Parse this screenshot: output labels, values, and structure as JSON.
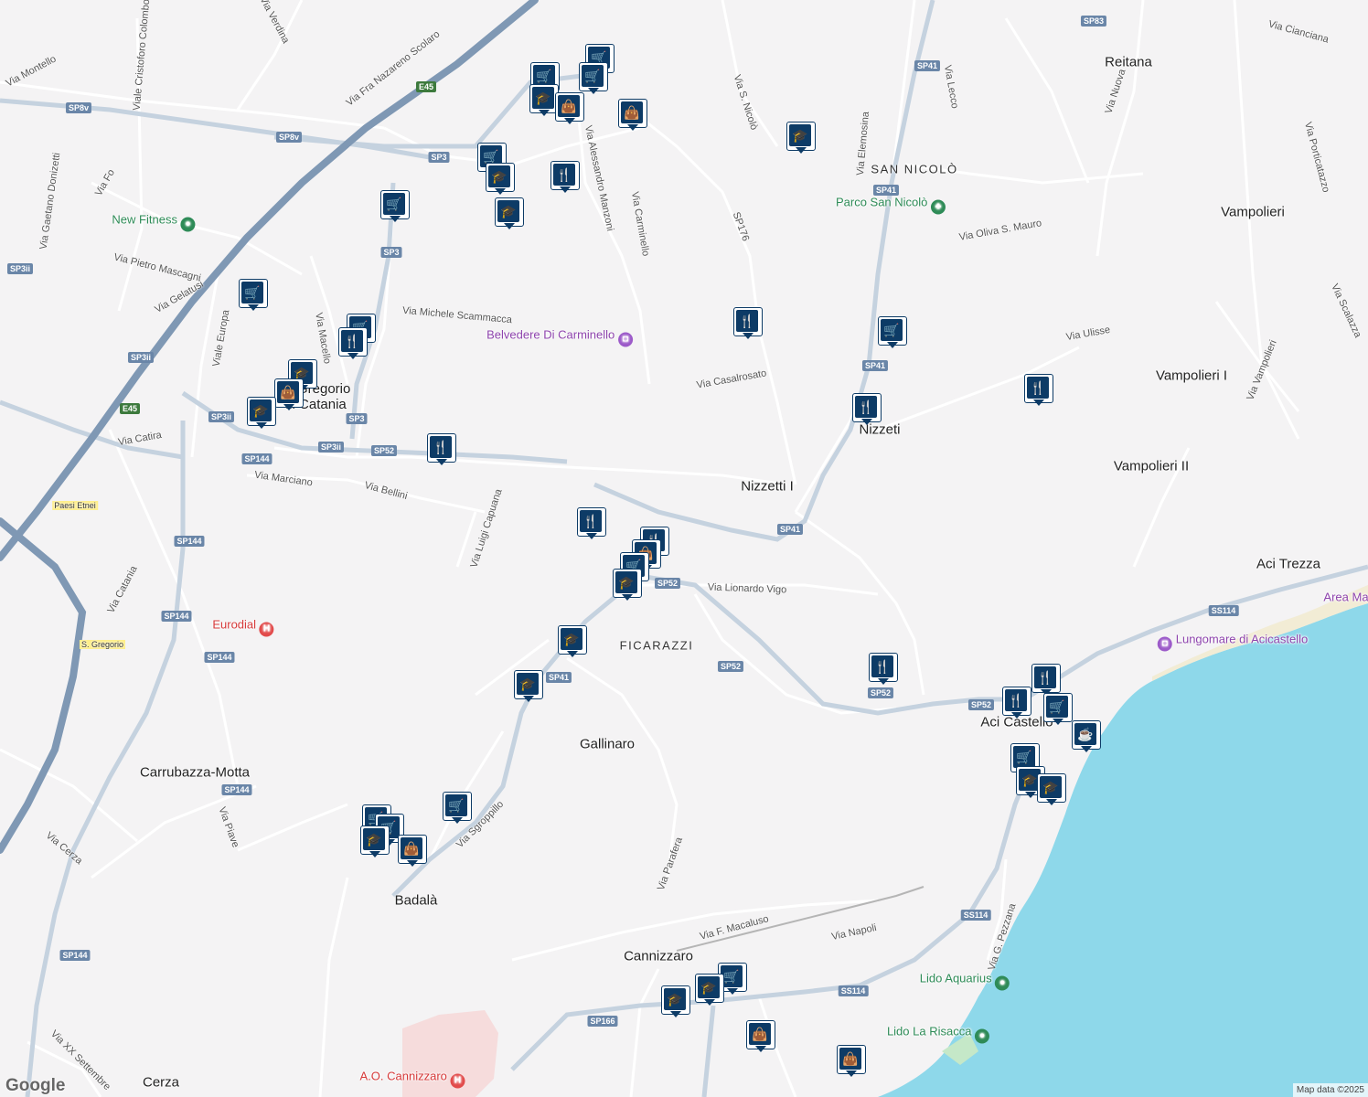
{
  "map": {
    "attribution": "Map data ©2025",
    "logo": "Google",
    "colors": {
      "land": "#f4f3f4",
      "sea": "#8ed8ea",
      "road": "#ffffff",
      "highway": "#7f98b4",
      "hospital_area": "#f6dcdc",
      "park_green": "#3d9a6a",
      "hospital_red": "#e24a4a",
      "attraction_purple": "#9c5ac9"
    },
    "places": [
      {
        "name": "Reitana"
      },
      {
        "name": "Vampolieri"
      },
      {
        "name": "Vampolieri I"
      },
      {
        "name": "Vampolieri II"
      },
      {
        "name": "Aci Trezza"
      },
      {
        "name": "Nizzeti"
      },
      {
        "name": "Nizzetti I"
      },
      {
        "name": "Gallinaro"
      },
      {
        "name": "Carrubazza-Motta"
      },
      {
        "name": "Badalà"
      },
      {
        "name": "Cerza"
      },
      {
        "name": "Aci Castello"
      },
      {
        "name": "Cannizzaro"
      },
      {
        "name": "S. Gregorio di Catania"
      }
    ],
    "localities": [
      {
        "name": "SAN NICOLÒ"
      },
      {
        "name": "FICARAZZI"
      }
    ],
    "pois": [
      {
        "name": "New Fitness",
        "kind": "park",
        "icon": "fitness-icon"
      },
      {
        "name": "Parco San Nicolò",
        "kind": "park",
        "icon": "tree-icon"
      },
      {
        "name": "Belvedere Di Carminello",
        "kind": "attraction",
        "icon": "camera-icon"
      },
      {
        "name": "Eurodial",
        "kind": "hospital",
        "icon": "hospital-icon"
      },
      {
        "name": "Lungomare di Acicastello",
        "kind": "attraction",
        "icon": "camera-icon"
      },
      {
        "name": "Lido Aquarius",
        "kind": "park",
        "icon": "beach-icon"
      },
      {
        "name": "Lido La Risacca",
        "kind": "park",
        "icon": "beach-icon"
      },
      {
        "name": "A.O. Cannizzaro",
        "kind": "hospital",
        "icon": "hospital-icon"
      },
      {
        "name": "Area Ma",
        "kind": "attraction",
        "icon": "none"
      }
    ],
    "streets": [
      {
        "name": "Via Montello"
      },
      {
        "name": "Viale Cristoforo Colombo"
      },
      {
        "name": "Via Verdina"
      },
      {
        "name": "Via Fra Nazareno Scolaro"
      },
      {
        "name": "Via Fo"
      },
      {
        "name": "Via Gaetano Donizetti"
      },
      {
        "name": "Via Pietro Mascagni"
      },
      {
        "name": "Via Gelatusi"
      },
      {
        "name": "Viale Europa"
      },
      {
        "name": "Via Macello"
      },
      {
        "name": "Via Michele Scammacca"
      },
      {
        "name": "Via Alessandro Manzoni"
      },
      {
        "name": "Via Carminello"
      },
      {
        "name": "Via S. Nicolò"
      },
      {
        "name": "Via Elemosina"
      },
      {
        "name": "Via Lecco"
      },
      {
        "name": "Via Nuova"
      },
      {
        "name": "Via Cianciana"
      },
      {
        "name": "Via Porticatazzo"
      },
      {
        "name": "Via Oliva S. Mauro"
      },
      {
        "name": "Via Casalrosato"
      },
      {
        "name": "Via Ulisse"
      },
      {
        "name": "Via Scalazza"
      },
      {
        "name": "Via Vampolieri"
      },
      {
        "name": "Via Catira"
      },
      {
        "name": "Via Marciano"
      },
      {
        "name": "Via Bellini"
      },
      {
        "name": "Via Luigi Capuana"
      },
      {
        "name": "Via Lionardo Vigo"
      },
      {
        "name": "Via Catania"
      },
      {
        "name": "Via Piave"
      },
      {
        "name": "Via Cerza"
      },
      {
        "name": "Via Sgroppillo"
      },
      {
        "name": "Via Parafera"
      },
      {
        "name": "Via F. Macaluso"
      },
      {
        "name": "Via Napoli"
      },
      {
        "name": "Via G. Pezzana"
      },
      {
        "name": "Via XX Settembre"
      },
      {
        "name": "Paesi Etnei"
      },
      {
        "name": "S. Gregorio"
      }
    ],
    "road_shields": [
      {
        "label": "SP8v"
      },
      {
        "label": "SP3"
      },
      {
        "label": "SP3ii"
      },
      {
        "label": "SP52"
      },
      {
        "label": "SP144"
      },
      {
        "label": "SP41"
      },
      {
        "label": "SP176"
      },
      {
        "label": "SP83"
      },
      {
        "label": "SS114"
      },
      {
        "label": "SP166"
      },
      {
        "label": "E45"
      }
    ],
    "marker_types": {
      "shopping": "shopping-cart-icon",
      "bag": "shopping-bag-icon",
      "restaurant": "fork-knife-icon",
      "school": "graduation-cap-icon",
      "cafe": "coffee-cup-icon"
    }
  }
}
